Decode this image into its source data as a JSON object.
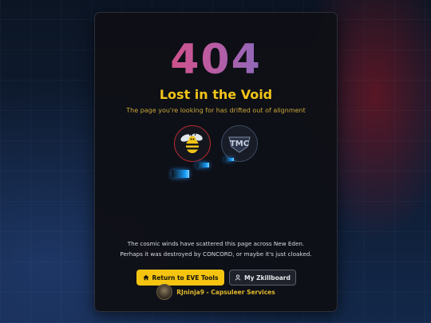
{
  "error": {
    "code": "404",
    "title": "Lost in the Void",
    "subtitle": "The page you're looking for has drifted out of alignment"
  },
  "message": {
    "line1": "The cosmic winds have scattered this page across New Eden.",
    "line2": "Perhaps it was destroyed by CONCORD, or maybe it's just cloaked."
  },
  "buttons": {
    "primary_label": "Return to EVE Tools",
    "secondary_label": "My Zkillboard"
  },
  "footer": {
    "text": "RJninja9 - Capsuleer Services"
  },
  "logos": {
    "bee_alliance_text": "",
    "tmc_text": "TMC"
  },
  "icons": {
    "primary_button_icon": "home-icon",
    "secondary_button_icon": "user-icon"
  },
  "colors": {
    "accent_yellow": "#f4c410",
    "gradient_start": "#ef3f5f",
    "gradient_end": "#4f7be0",
    "streak_blue": "#18a0ff"
  }
}
